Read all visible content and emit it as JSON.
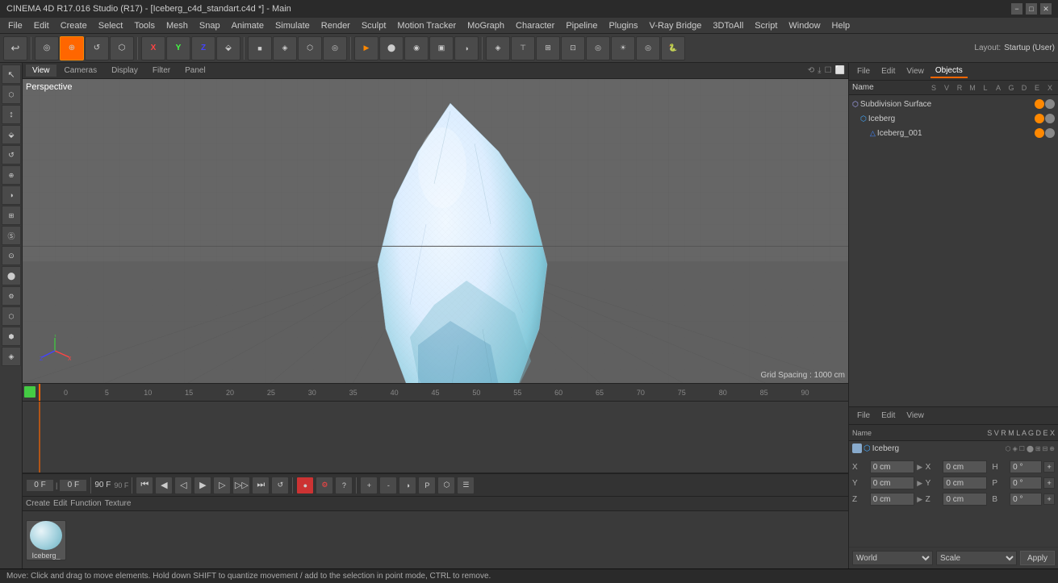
{
  "titlebar": {
    "title": "CINEMA 4D R17.016 Studio (R17) - [Iceberg_c4d_standart.c4d *] - Main",
    "minimize": "−",
    "maximize": "□",
    "close": "✕"
  },
  "menubar": {
    "items": [
      "File",
      "Edit",
      "Create",
      "Select",
      "Tools",
      "Mesh",
      "Snap",
      "Animate",
      "Simulate",
      "Render",
      "Sculpt",
      "Motion Tracker",
      "MoGraph",
      "Character",
      "Pipeline",
      "Plugins",
      "V-Ray Bridge",
      "3DToAll",
      "Script",
      "Window",
      "Help"
    ]
  },
  "toolbar": {
    "undo_label": "↩",
    "mode_btns": [
      "⊙",
      "⊕",
      "⊗",
      "⊘"
    ],
    "transform_btns": [
      "X",
      "Y",
      "Z",
      "⬙"
    ],
    "view_btns": [
      "▣",
      "◉",
      "⬡",
      "◈",
      "◆",
      "⬤",
      "◑",
      "⊞"
    ],
    "layout_label": "Layout:",
    "layout_value": "Startup (User)"
  },
  "left_tools": {
    "tools": [
      "↖",
      "⬡",
      "↕",
      "⟳",
      "◎",
      "▣",
      "✦",
      "⊹",
      "Ⓢ",
      "⊙",
      "⬤",
      "⚙",
      "⬡",
      "⬢",
      "◈"
    ]
  },
  "viewport": {
    "label": "Perspective",
    "grid_spacing": "Grid Spacing : 1000 cm",
    "tabs": [
      "View",
      "Cameras",
      "Display",
      "Filter",
      "Panel"
    ],
    "tab_icons": [
      "⟲",
      "⤓",
      "☐",
      "⬜"
    ]
  },
  "right_panel": {
    "top_tabs": [
      "File",
      "Edit",
      "View",
      "Objects"
    ],
    "obj_cols": {
      "name": "Name",
      "cols": [
        "S",
        "V",
        "R",
        "M",
        "L",
        "A",
        "G",
        "D",
        "E",
        "X"
      ]
    },
    "objects": [
      {
        "name": "Subdivision Surface",
        "indent": 0,
        "icon": "⬡",
        "icon_color": "#aaaaff",
        "dot1": "orange",
        "dot2": "gray",
        "has_children": true
      },
      {
        "name": "Iceberg",
        "indent": 1,
        "icon": "⬡",
        "icon_color": "#44aaff",
        "dot1": "orange",
        "dot2": "gray",
        "has_children": false
      },
      {
        "name": "Iceberg_001",
        "indent": 2,
        "icon": "△",
        "icon_color": "#4488ff",
        "dot1": "orange",
        "dot2": "gray",
        "has_children": false
      }
    ],
    "bottom_tabs": [
      "File",
      "Edit",
      "View"
    ],
    "obj_name_header": {
      "name_col": "Name",
      "other_cols": [
        "S",
        "V",
        "R",
        "M",
        "L",
        "A",
        "G",
        "D",
        "E",
        "X"
      ]
    },
    "object_in_bottom": {
      "name": "Iceberg",
      "icon_color": "#44aaff"
    }
  },
  "coords": {
    "rows": [
      {
        "label": "X",
        "val1": "0 cm",
        "label2": "X",
        "val2": "0 cm",
        "label3": "H",
        "val3": "0 °"
      },
      {
        "label": "Y",
        "val1": "0 cm",
        "label2": "Y",
        "val2": "0 cm",
        "label3": "P",
        "val3": "0 °"
      },
      {
        "label": "Z",
        "val1": "0 cm",
        "label2": "Z",
        "val2": "0 cm",
        "label3": "B",
        "val3": "0 °"
      }
    ],
    "world_label": "World",
    "scale_label": "Scale",
    "apply_label": "Apply"
  },
  "timeline": {
    "header_tabs": [],
    "frame_start": "0 F",
    "frame_end": "90 F",
    "current_frame": "0 F",
    "frame_marks": [
      "0",
      "5",
      "10",
      "15",
      "20",
      "25",
      "30",
      "35",
      "40",
      "45",
      "50",
      "55",
      "60",
      "65",
      "70",
      "75",
      "80",
      "85",
      "90"
    ],
    "playback": {
      "current": "0 F",
      "start": "0",
      "end_val": "90 F",
      "end2": "90 F",
      "fps": "90 F"
    }
  },
  "content_manager": {
    "tabs": [
      "Create",
      "Edit",
      "Function",
      "Texture"
    ],
    "materials": [
      {
        "name": "Iceberg_",
        "thumb_type": "iceberg"
      }
    ]
  },
  "statusbar": {
    "text": "Move: Click and drag to move elements. Hold down SHIFT to quantize movement / add to the selection in point mode, CTRL to remove."
  }
}
